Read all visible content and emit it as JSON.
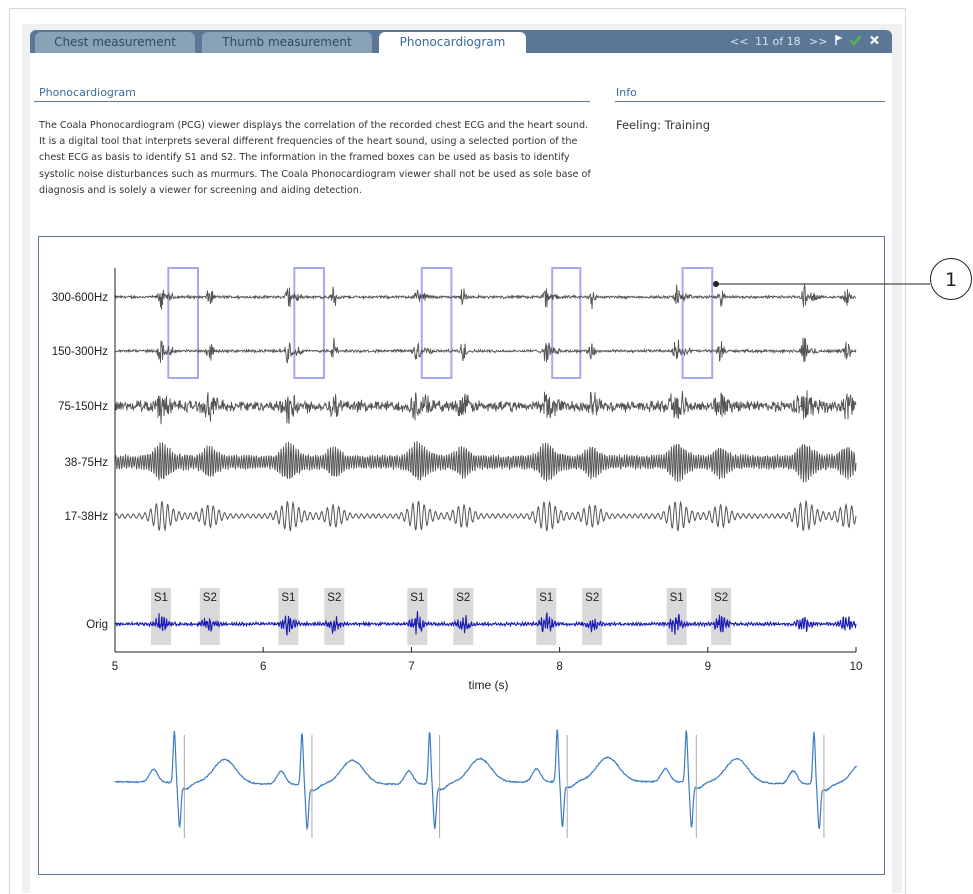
{
  "tabs": [
    {
      "label": "Chest measurement",
      "active": false
    },
    {
      "label": "Thumb measurement",
      "active": false
    },
    {
      "label": "Phonocardiogram",
      "active": true
    }
  ],
  "pager": {
    "prev": "<<",
    "position": "11 of 18",
    "next": ">>"
  },
  "toolbar_icons": [
    "flag-icon",
    "check-icon",
    "close-icon"
  ],
  "colors": {
    "tab_bar": "#5a7896",
    "accent": "#3b6b9a",
    "check": "#5ab84a",
    "pcg_trace": "#555555",
    "orig_trace": "#1a1ab4",
    "ecg_trace": "#3a7cc4",
    "frame_box": "#a8a8f0",
    "s_marker": "#d9d9d9"
  },
  "section": {
    "title": "Phonocardiogram",
    "description": "The Coala Phonocardiogram (PCG) viewer displays the correlation of the recorded chest ECG and the heart sound. It is a digital tool that interprets several different frequencies of the heart sound, using a selected portion of the chest ECG as basis to identify S1 and S2. The information in the framed boxes can be used as basis to identify systolic noise disturbances such as murmurs. The Coala Phonocardiogram viewer shall not be used as sole base of diagnosis and is solely a viewer for screening and aiding detection."
  },
  "info": {
    "title": "Info",
    "feeling": "Feeling: Training"
  },
  "callout": "1",
  "chart_data": {
    "type": "line",
    "xlabel": "time (s)",
    "xlim": [
      5,
      10
    ],
    "xticks": [
      5,
      6,
      7,
      8,
      9,
      10
    ],
    "series": [
      {
        "name": "300-600Hz"
      },
      {
        "name": "150-300Hz"
      },
      {
        "name": "75-150Hz"
      },
      {
        "name": "38-75Hz"
      },
      {
        "name": "17-38Hz"
      },
      {
        "name": "Orig"
      }
    ],
    "heartbeats": [
      {
        "s1": 5.31,
        "s2": 5.64
      },
      {
        "s1": 6.17,
        "s2": 6.48
      },
      {
        "s1": 7.04,
        "s2": 7.35
      },
      {
        "s1": 7.91,
        "s2": 8.22
      },
      {
        "s1": 8.79,
        "s2": 9.09
      },
      {
        "s1": 9.65,
        "s2": 9.94
      }
    ],
    "s_labels": [
      {
        "label": "S1",
        "t": 5.31
      },
      {
        "label": "S2",
        "t": 5.64
      },
      {
        "label": "S1",
        "t": 6.17
      },
      {
        "label": "S2",
        "t": 6.48
      },
      {
        "label": "S1",
        "t": 7.04
      },
      {
        "label": "S2",
        "t": 7.35
      },
      {
        "label": "S1",
        "t": 7.91
      },
      {
        "label": "S2",
        "t": 8.22
      },
      {
        "label": "S1",
        "t": 8.79
      },
      {
        "label": "S2",
        "t": 9.09
      }
    ],
    "frames": [
      {
        "t0": 5.36,
        "t1": 5.56
      },
      {
        "t0": 6.21,
        "t1": 6.41
      },
      {
        "t0": 7.07,
        "t1": 7.27
      },
      {
        "t0": 7.95,
        "t1": 8.14
      },
      {
        "t0": 8.83,
        "t1": 9.03
      }
    ]
  }
}
